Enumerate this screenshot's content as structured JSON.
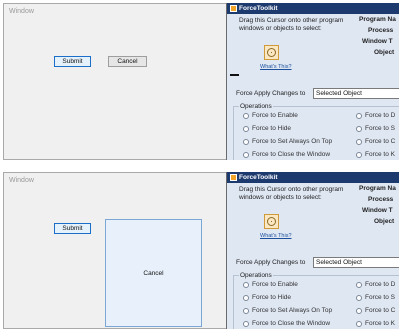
{
  "demo_window": {
    "title": "Window",
    "submit_label": "Submit",
    "cancel_label": "Cancel"
  },
  "force_toolkit": {
    "title": "ForceToolkit",
    "drag_instructions": "Drag this Cursor onto other program windows or objects to select:",
    "whats_this": "What's This?",
    "properties": [
      "Program Na",
      "Process",
      "Window T",
      "Object"
    ],
    "force_apply_label": "Force Apply Changes to",
    "force_apply_value": "Selected Object",
    "operations_title": "Operations",
    "operations_left": [
      "Force to Enable",
      "Force to Hide",
      "Force to Set Always On Top",
      "Force to Close the Window"
    ],
    "operations_right": [
      "Force to D",
      "Force to S",
      "Force to C",
      "Force to K"
    ]
  },
  "colors": {
    "title_bar": "#1d3a6e",
    "panel_bg": "#dfe7f3",
    "default_button_border": "#1c6fc9"
  }
}
